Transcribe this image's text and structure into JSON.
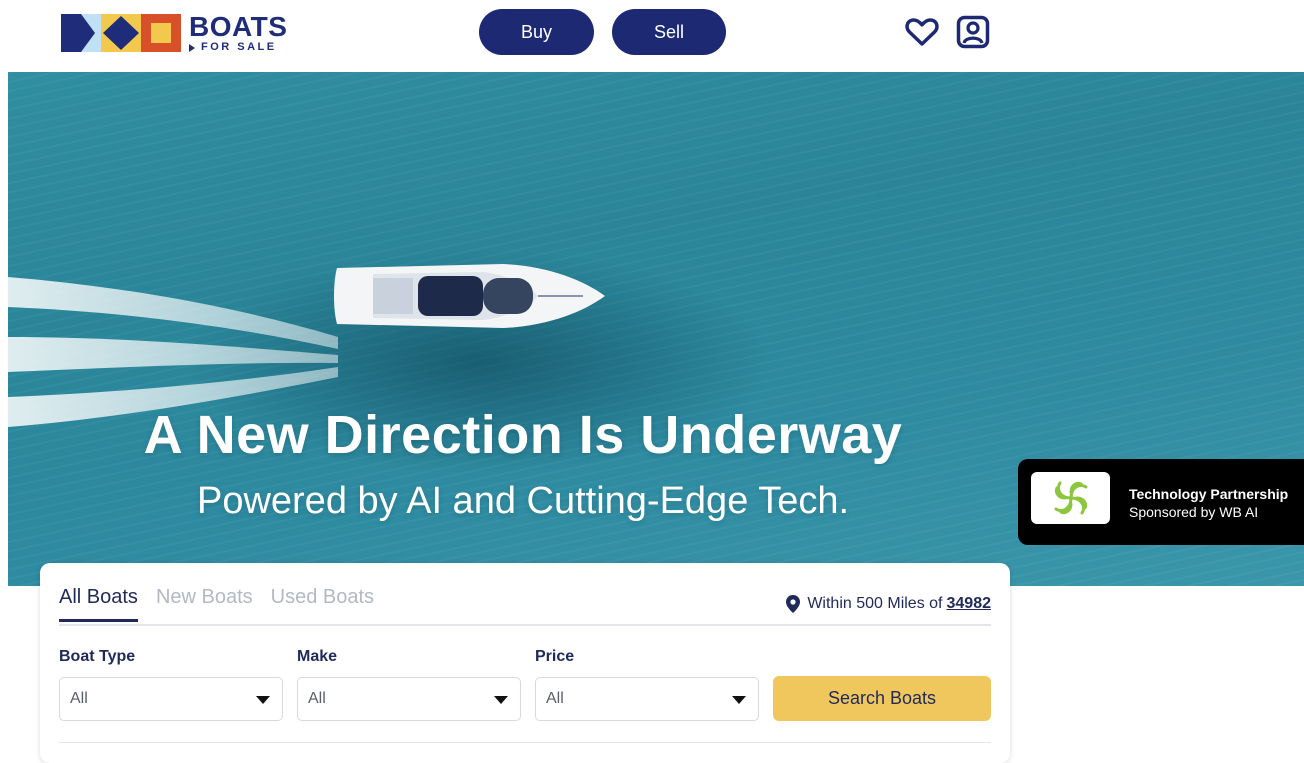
{
  "brand": {
    "name_main": "BOATS",
    "name_sub": "FOR SALE"
  },
  "nav": {
    "buy": "Buy",
    "sell": "Sell",
    "favorites_icon": "heart-icon",
    "account_icon": "account-icon"
  },
  "hero": {
    "title": "A New Direction Is Underway",
    "subtitle": "Powered by AI and Cutting-Edge Tech."
  },
  "partner": {
    "title": "Technology Partnership",
    "subtitle": "Sponsored by WB AI"
  },
  "search": {
    "tabs": [
      "All Boats",
      "New Boats",
      "Used Boats"
    ],
    "active_tab": "All Boats",
    "location_prefix": "Within 500 Miles of",
    "zip": "34982",
    "fields": [
      {
        "label": "Boat Type",
        "value": "All"
      },
      {
        "label": "Make",
        "value": "All"
      },
      {
        "label": "Price",
        "value": "All"
      }
    ],
    "submit": "Search Boats"
  },
  "colors": {
    "navy": "#1d2a73",
    "gold": "#f0c75d",
    "ocean": "#2d8aa0"
  }
}
